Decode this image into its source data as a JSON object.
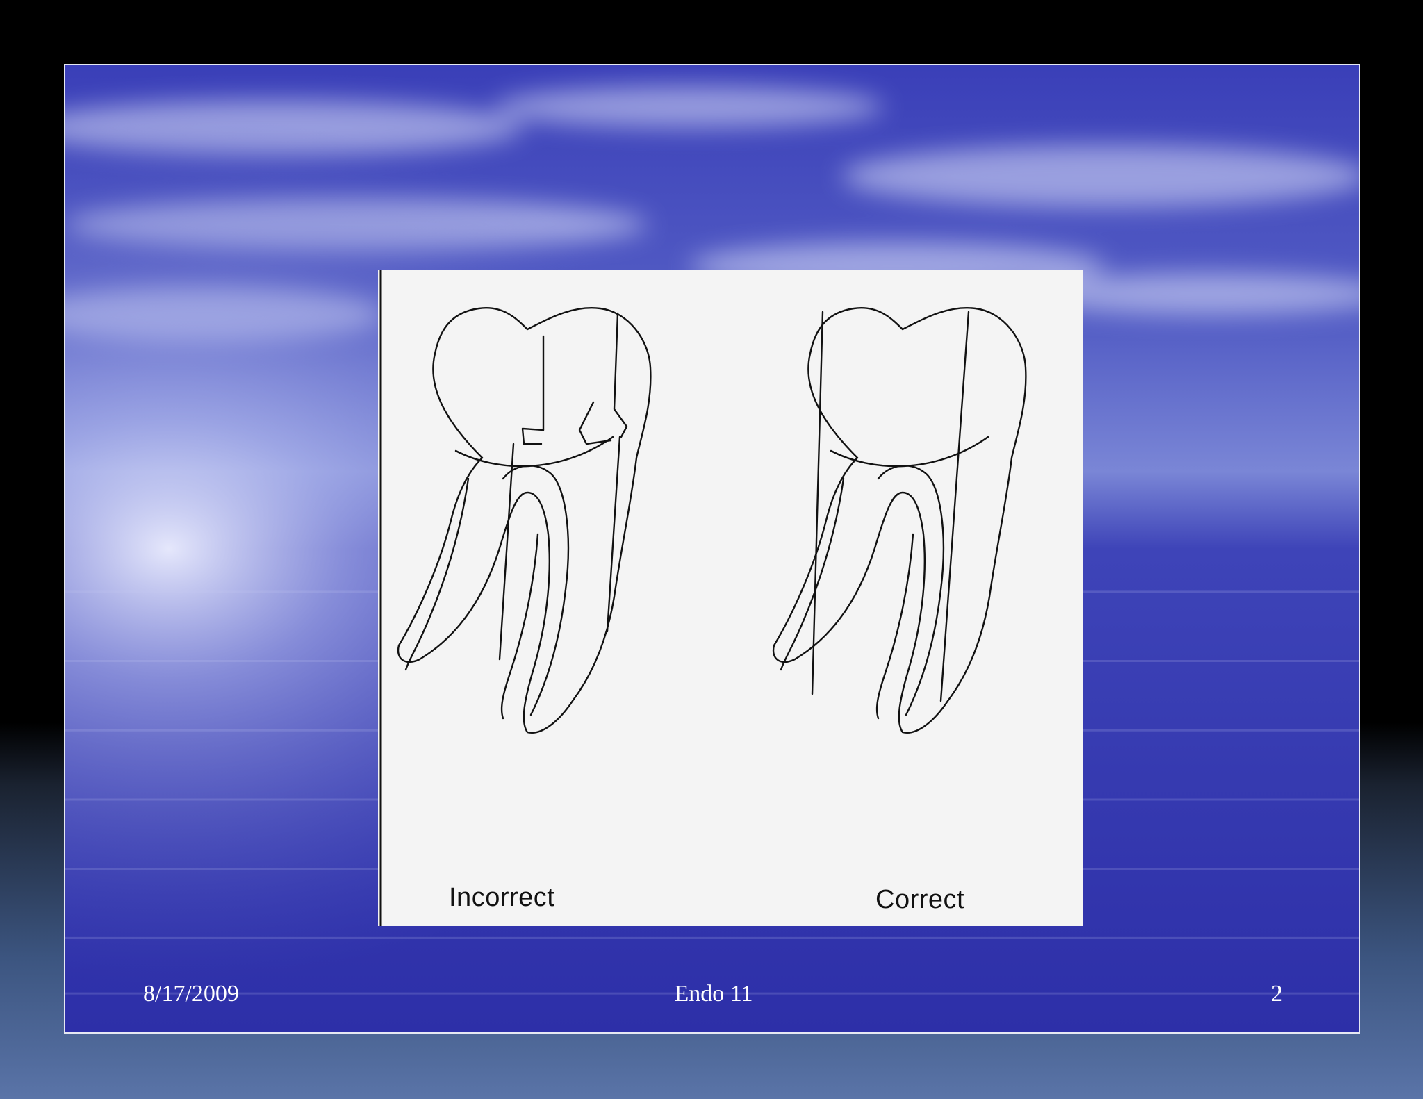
{
  "slide": {
    "figure": {
      "label_left": "Incorrect",
      "label_right": "Correct"
    },
    "footer": {
      "date": "8/17/2009",
      "title": "Endo 11",
      "page_number": "2"
    }
  },
  "colors": {
    "slide_background": "#3a3cb6",
    "figure_background": "#f4f4f4",
    "footer_text": "#ffffff"
  }
}
